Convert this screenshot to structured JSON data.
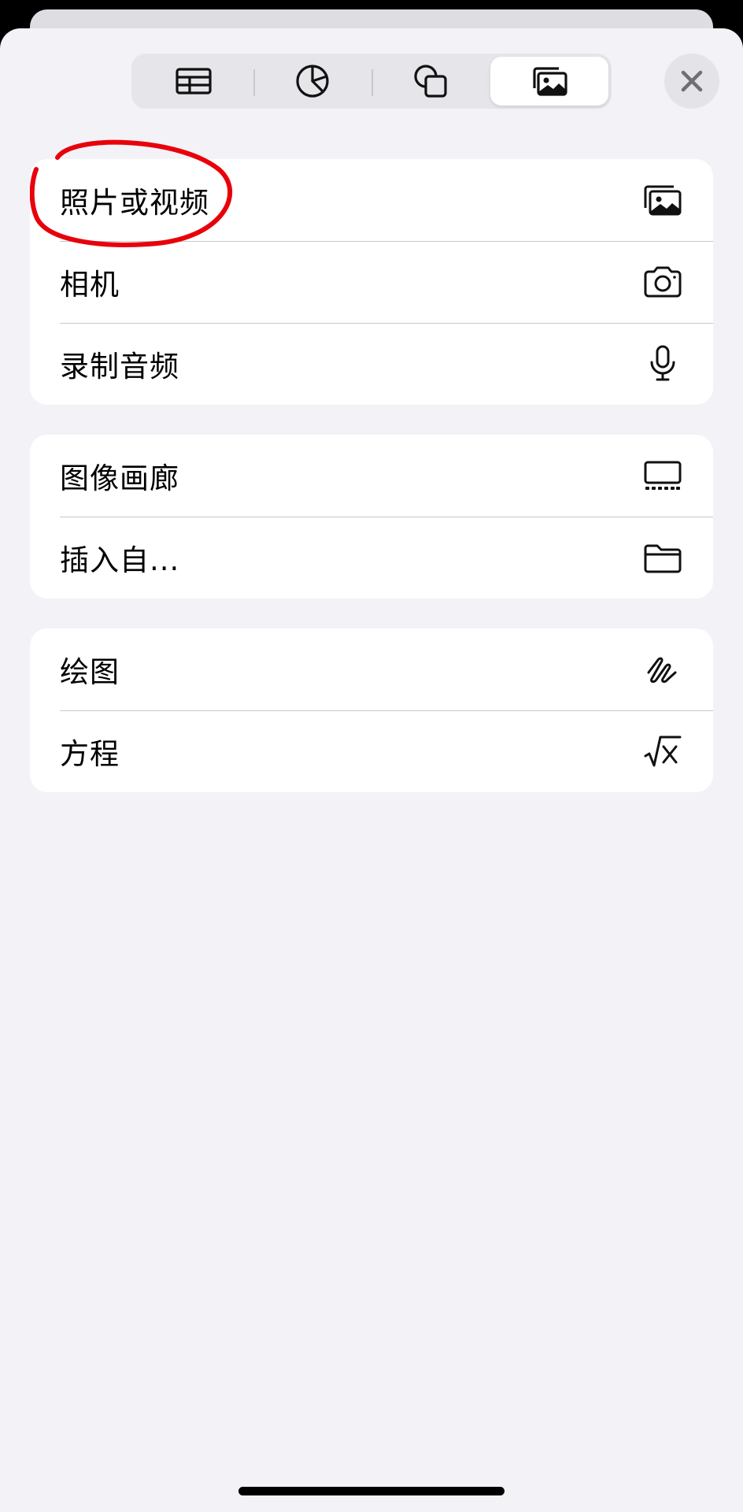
{
  "toolbar": {
    "segments": [
      {
        "icon": "table-icon",
        "active": false
      },
      {
        "icon": "chart-icon",
        "active": false
      },
      {
        "icon": "shapes-icon",
        "active": false
      },
      {
        "icon": "media-icon",
        "active": true
      }
    ],
    "close_icon": "close-icon"
  },
  "groups": [
    {
      "items": [
        {
          "label": "照片或视频",
          "icon": "photo-library-icon"
        },
        {
          "label": "相机",
          "icon": "camera-icon"
        },
        {
          "label": "录制音频",
          "icon": "microphone-icon"
        }
      ]
    },
    {
      "items": [
        {
          "label": "图像画廊",
          "icon": "image-gallery-icon"
        },
        {
          "label": "插入自...",
          "icon": "folder-icon"
        }
      ]
    },
    {
      "items": [
        {
          "label": "绘图",
          "icon": "drawing-icon"
        },
        {
          "label": "方程",
          "icon": "equation-icon"
        }
      ]
    }
  ],
  "colors": {
    "annotation": "#e8000b",
    "sheet_background": "#f2f2f7",
    "card_background": "#ffffff"
  }
}
